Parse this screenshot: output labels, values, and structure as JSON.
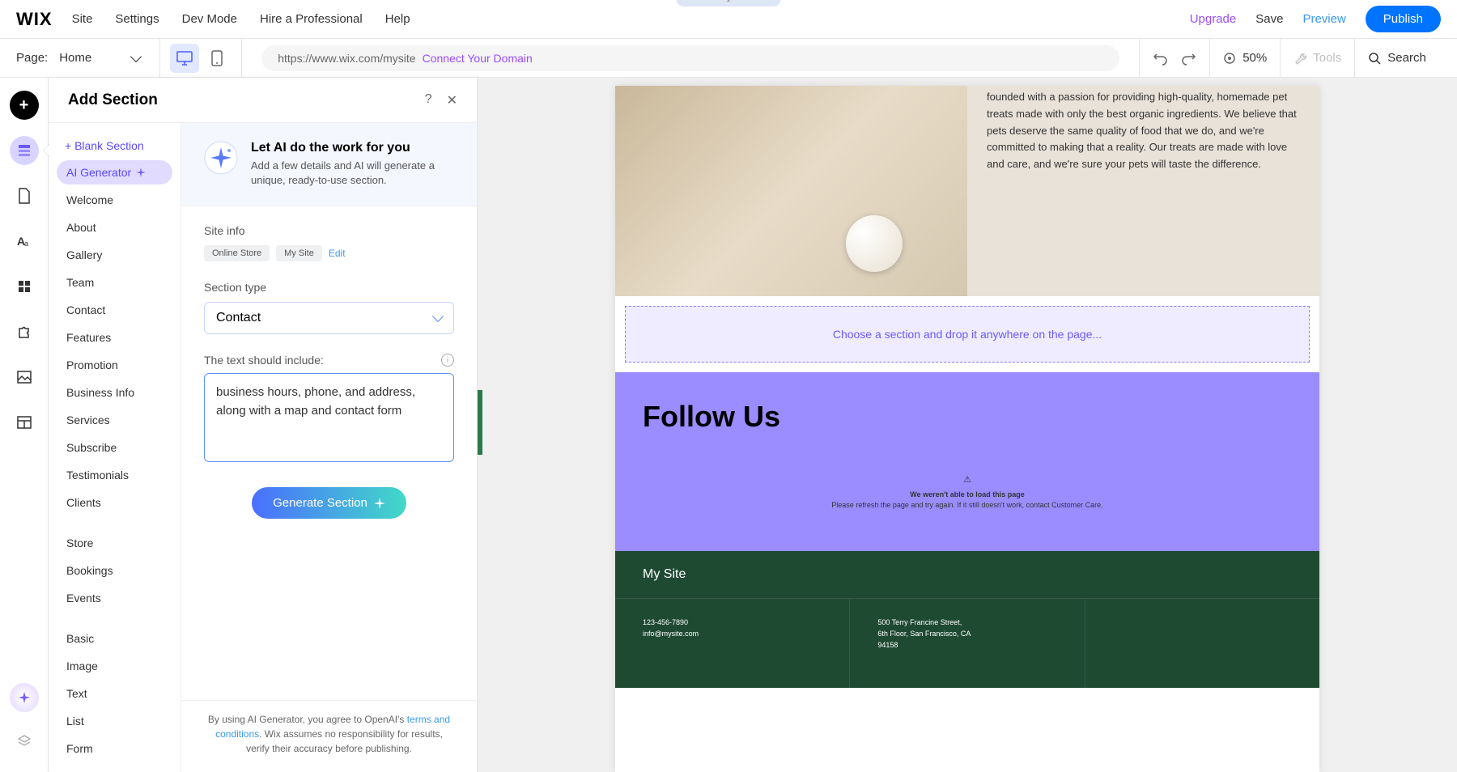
{
  "topbar": {
    "logo": "WIX",
    "menu": [
      "Site",
      "Settings",
      "Dev Mode",
      "Hire a Professional",
      "Help"
    ],
    "upgrade": "Upgrade",
    "save": "Save",
    "preview": "Preview",
    "publish": "Publish"
  },
  "secondbar": {
    "page_label": "Page:",
    "page_name": "Home",
    "url": "https://www.wix.com/mysite",
    "domain_cta": "Connect Your Domain",
    "zoom": "50%",
    "tools": "Tools",
    "search": "Search"
  },
  "panel": {
    "title": "Add Section",
    "blank": "+  Blank Section",
    "ai_gen": "AI Generator",
    "categories_a": [
      "Welcome",
      "About",
      "Gallery",
      "Team",
      "Contact",
      "Features",
      "Promotion",
      "Business Info",
      "Services",
      "Subscribe",
      "Testimonials",
      "Clients"
    ],
    "categories_b": [
      "Store",
      "Bookings",
      "Events"
    ],
    "categories_c": [
      "Basic",
      "Image",
      "Text",
      "List",
      "Form"
    ],
    "intro_title": "Let AI do the work for you",
    "intro_desc": "Add a few details and AI will generate a unique, ready-to-use section.",
    "siteinfo_label": "Site info",
    "tag1": "Online Store",
    "tag2": "My Site",
    "edit": "Edit",
    "section_type_label": "Section type",
    "section_type_value": "Contact",
    "text_include_label": "The text should include:",
    "textarea_value": "business hours, phone, and address, along with a map and contact form",
    "generate": "Generate Section",
    "disclaimer_1": "By using AI Generator, you agree to OpenAI's ",
    "disclaimer_link": "terms and conditions",
    "disclaimer_2": ". Wix assumes no responsibility for results, verify their accuracy before publishing."
  },
  "preview": {
    "hero_text": "founded with a passion for providing high-quality, homemade pet treats made with only the best organic ingredients. We believe that pets deserve the same quality of food that we do, and we're committed to making that a reality. Our treats are made with love and care, and we're sure your pets will taste the difference.",
    "dropzone": "Choose a section and drop it anywhere on the page...",
    "follow": "Follow Us",
    "error_title": "We weren't able to load this page",
    "error_desc": "Please refresh the page and try again. If it still doesn't work, contact Customer Care.",
    "footer_title": "My Site",
    "footer_phone": "123-456-7890",
    "footer_email": "info@mysite.com",
    "footer_addr1": "500 Terry Francine Street,",
    "footer_addr2": "6th Floor, San Francisco, CA",
    "footer_addr3": "94158"
  }
}
